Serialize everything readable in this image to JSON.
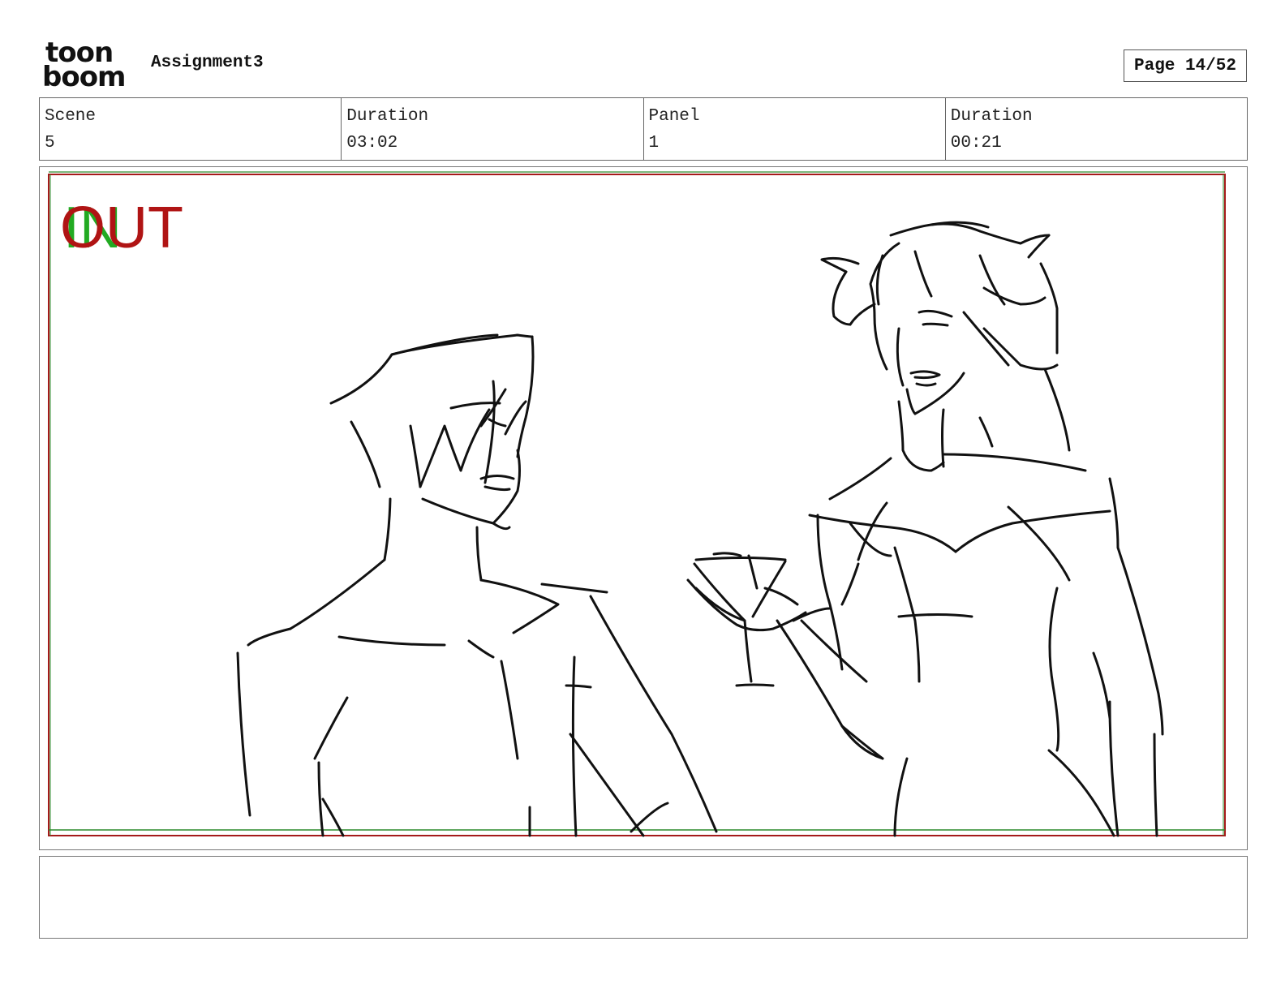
{
  "header": {
    "logo_top": "toon",
    "logo_bottom": "boom",
    "project_title": "Assignment3",
    "page_label": "Page 14/52"
  },
  "info": {
    "scene_label": "Scene",
    "scene_value": "5",
    "scene_duration_label": "Duration",
    "scene_duration_value": "03:02",
    "panel_label": "Panel",
    "panel_value": "1",
    "panel_duration_label": "Duration",
    "panel_duration_value": "00:21"
  },
  "panel": {
    "in_marker": "IN",
    "out_marker": "OUT",
    "colors": {
      "frame_red": "#a51a1a",
      "frame_green": "#2a8a2a",
      "in_green": "#22aa22",
      "out_red": "#b01414",
      "ink": "#111111"
    }
  },
  "caption": {
    "text": ""
  }
}
